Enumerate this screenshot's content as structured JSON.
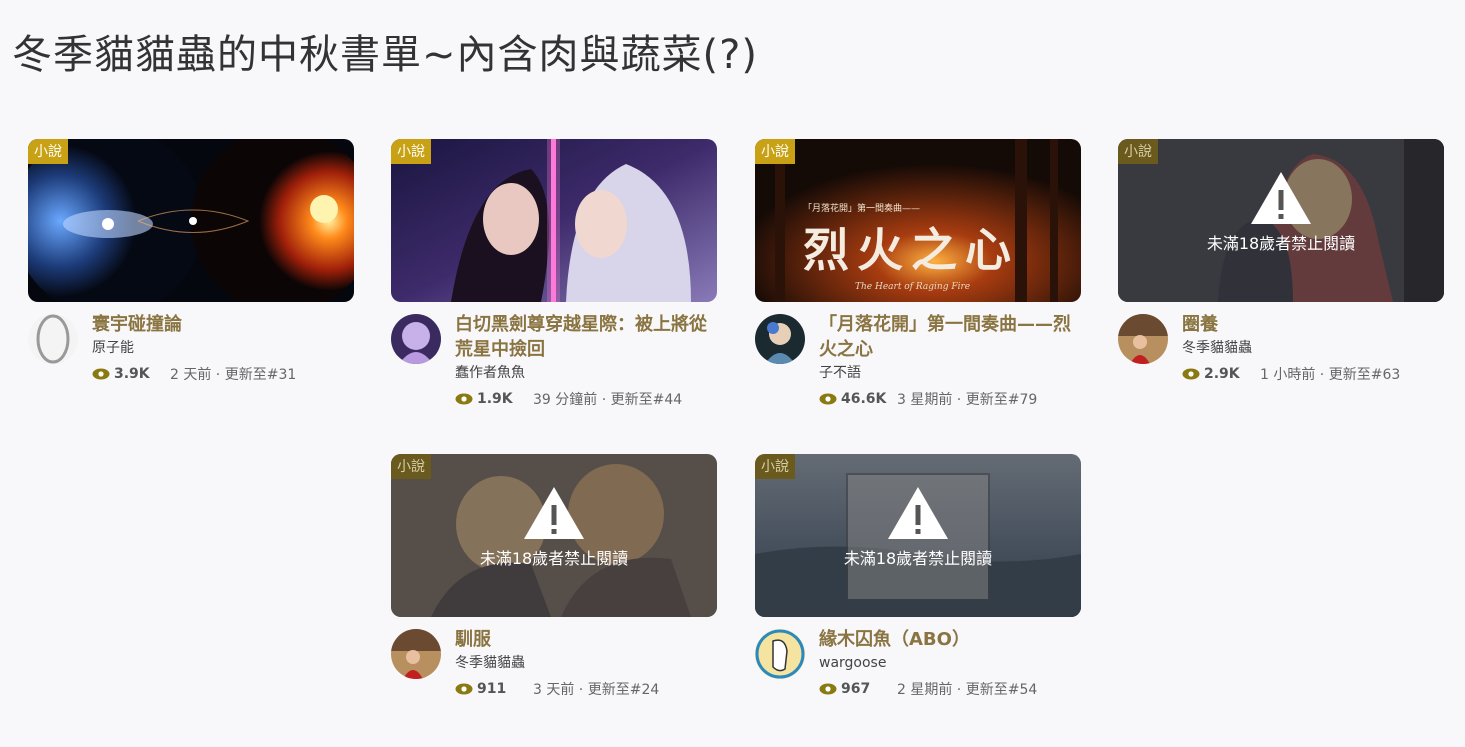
{
  "page": {
    "title": "冬季貓貓蟲的中秋書單~內含肉與蔬菜(?)"
  },
  "colors": {
    "tag": "#c8a214",
    "title": "#8a7442",
    "eye": "#8a7a12"
  },
  "cards": [
    {
      "tag": "小說",
      "title": "寰宇碰撞論",
      "author": "原子能",
      "views": "3.9K",
      "updated": "2 天前 · 更新至#31",
      "restricted": false
    },
    {
      "tag": "小說",
      "title": "白切黑劍尊穿越星際：被上將從荒星中撿回",
      "author": "蠢作者魚魚",
      "views": "1.9K",
      "updated": "39 分鐘前 · 更新至#44",
      "restricted": false
    },
    {
      "tag": "小說",
      "title": "「月落花開」第一間奏曲——烈火之心",
      "author": "子不語",
      "views": "46.6K",
      "updated": "3 星期前 · 更新至#79",
      "restricted": false,
      "cover_text": "烈火之心",
      "cover_small": "「月落花開」第一間奏曲——",
      "cover_script": "The Heart of Raging Fire"
    },
    {
      "tag": "小說",
      "title": "圈養",
      "author": "冬季貓貓蟲",
      "views": "2.9K",
      "updated": "1 小時前 · 更新至#63",
      "restricted": true,
      "lock_text": "未滿18歲者禁止閱讀"
    },
    {
      "tag": "小說",
      "title": "馴服",
      "author": "冬季貓貓蟲",
      "views": "911",
      "updated": "3 天前 · 更新至#24",
      "restricted": true,
      "lock_text": "未滿18歲者禁止閱讀"
    },
    {
      "tag": "小說",
      "title": "緣木囚魚（ABO）",
      "author": "wargoose",
      "views": "967",
      "updated": "2 星期前 · 更新至#54",
      "restricted": true,
      "lock_text": "未滿18歲者禁止閱讀"
    }
  ]
}
